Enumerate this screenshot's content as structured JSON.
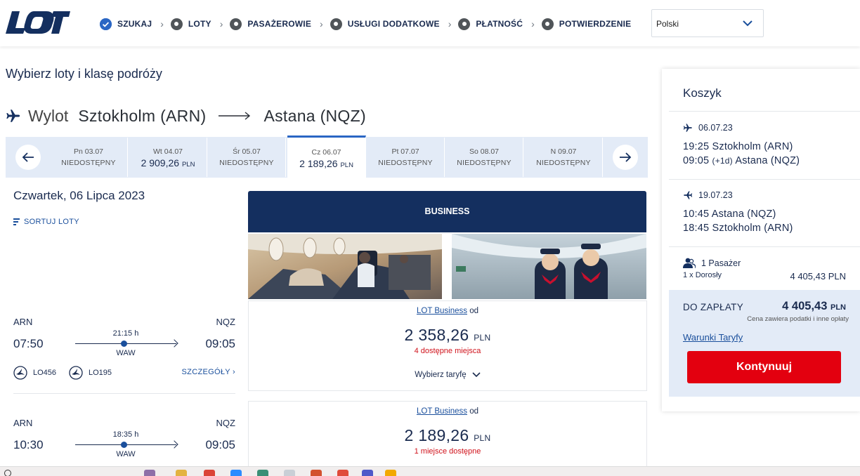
{
  "header": {
    "logo_text": "LOT",
    "steps": [
      {
        "label": "SZUKAJ",
        "done": true
      },
      {
        "label": "LOTY",
        "done": false
      },
      {
        "label": "PASAŻEROWIE",
        "done": false
      },
      {
        "label": "USŁUGI DODATKOWE",
        "done": false
      },
      {
        "label": "PŁATNOŚĆ",
        "done": false
      },
      {
        "label": "POTWIERDZENIE",
        "done": false
      }
    ],
    "language": "Polski"
  },
  "page_title": "Wybierz loty i klasę podróży",
  "route": {
    "kind": "Wylot",
    "from": "Sztokholm (ARN)",
    "to": "Astana (NQZ)"
  },
  "dates": [
    {
      "day": "Pn 03.07",
      "status": "NIEDOSTĘPNY",
      "price": null,
      "currency": null,
      "selected": false
    },
    {
      "day": "Wt 04.07",
      "status": null,
      "price": "2 909,26",
      "currency": "PLN",
      "selected": false
    },
    {
      "day": "Śr 05.07",
      "status": "NIEDOSTĘPNY",
      "price": null,
      "currency": null,
      "selected": false
    },
    {
      "day": "Cz 06.07",
      "status": null,
      "price": "2 189,26",
      "currency": "PLN",
      "selected": true
    },
    {
      "day": "Pt 07.07",
      "status": "NIEDOSTĘPNY",
      "price": null,
      "currency": null,
      "selected": false
    },
    {
      "day": "So 08.07",
      "status": "NIEDOSTĘPNY",
      "price": null,
      "currency": null,
      "selected": false
    },
    {
      "day": "N 09.07",
      "status": "NIEDOSTĘPNY",
      "price": null,
      "currency": null,
      "selected": false
    }
  ],
  "day_title": "Czwartek, 06 Lipca 2023",
  "sort_label": "SORTUJ LOTY",
  "cabin_header": "BUSINESS",
  "flights": [
    {
      "from": "ARN",
      "to": "NQZ",
      "dep": "07:50",
      "arr": "09:05",
      "duration": "21:15 h",
      "via": "WAW",
      "flight_numbers": [
        "LO456",
        "LO195"
      ],
      "details_label": "SZCZEGÓŁY"
    },
    {
      "from": "ARN",
      "to": "NQZ",
      "dep": "10:30",
      "arr": "09:05",
      "duration": "18:35 h",
      "via": "WAW"
    }
  ],
  "fares": [
    {
      "name": "LOT Business",
      "od": "od",
      "price": "2 358,26",
      "currency": "PLN",
      "seats": "4 dostępne miejsca",
      "choose_label": "Wybierz taryfę"
    },
    {
      "name": "LOT Business",
      "od": "od",
      "price": "2 189,26",
      "currency": "PLN",
      "seats": "1 miejsce dostępne"
    }
  ],
  "cart": {
    "title": "Koszyk",
    "legs": [
      {
        "date": "06.07.23",
        "rows": [
          {
            "time": "19:25",
            "plus": "",
            "place": "Sztokholm (ARN)"
          },
          {
            "time": "09:05",
            "plus": "(+1d)",
            "place": "Astana (NQZ)"
          }
        ]
      },
      {
        "date": "19.07.23",
        "rows": [
          {
            "time": "10:45",
            "plus": "",
            "place": "Astana (NQZ)"
          },
          {
            "time": "18:45",
            "plus": "",
            "place": "Sztokholm (ARN)"
          }
        ]
      }
    ],
    "passengers_title": "1 Pasażer",
    "passenger_line": "1 x Dorosły",
    "passenger_amount": "4 405,43 PLN",
    "to_pay_label": "DO ZAPŁATY",
    "to_pay_amount": "4 405,43",
    "to_pay_currency": "PLN",
    "to_pay_note": "Cena zawiera podatki i inne opłaty",
    "terms_label": "Warunki Taryfy",
    "continue_label": "Kontynuuj"
  },
  "colors": {
    "navy": "#142f5f",
    "text": "#1a2b4f",
    "link": "#1a4f9c",
    "accent_blue": "#2a66c4",
    "light_blue": "#e3ebf7",
    "red": "#e3000f",
    "seats_red": "#d0121b"
  }
}
